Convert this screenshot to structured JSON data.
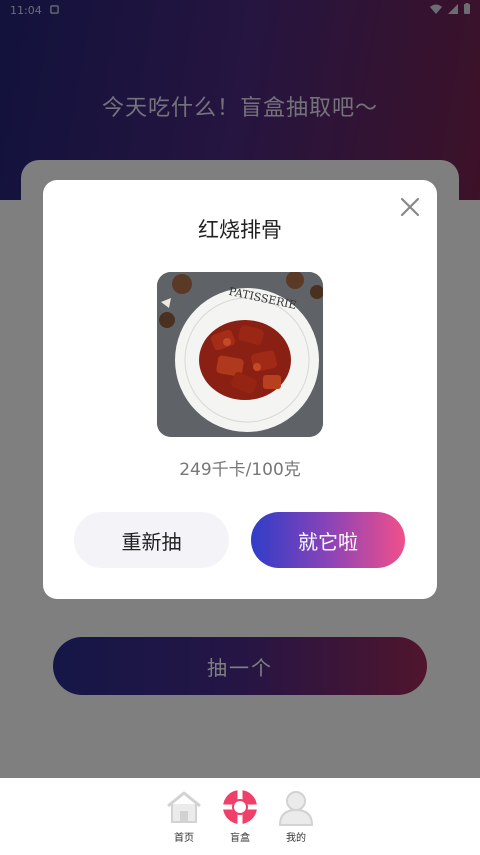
{
  "status_bar": {
    "time": "11:04"
  },
  "hero": {
    "title": "今天吃什么！盲盒抽取吧～"
  },
  "main": {
    "draw_button_label": "抽一个"
  },
  "dialog": {
    "dish_name": "红烧排骨",
    "calories": "249千卡/100克",
    "retry_label": "重新抽",
    "confirm_label": "就它啦",
    "photo_plate_text": "PATISSERIE"
  },
  "tabbar": {
    "items": [
      {
        "label": "首页",
        "icon": "home-icon"
      },
      {
        "label": "盲盒",
        "icon": "lifebuoy-icon"
      },
      {
        "label": "我的",
        "icon": "user-icon"
      }
    ]
  },
  "colors": {
    "accent_gradient_start": "#2f3dc8",
    "accent_gradient_end": "#f0508a",
    "tab_active": "#f0406a"
  }
}
